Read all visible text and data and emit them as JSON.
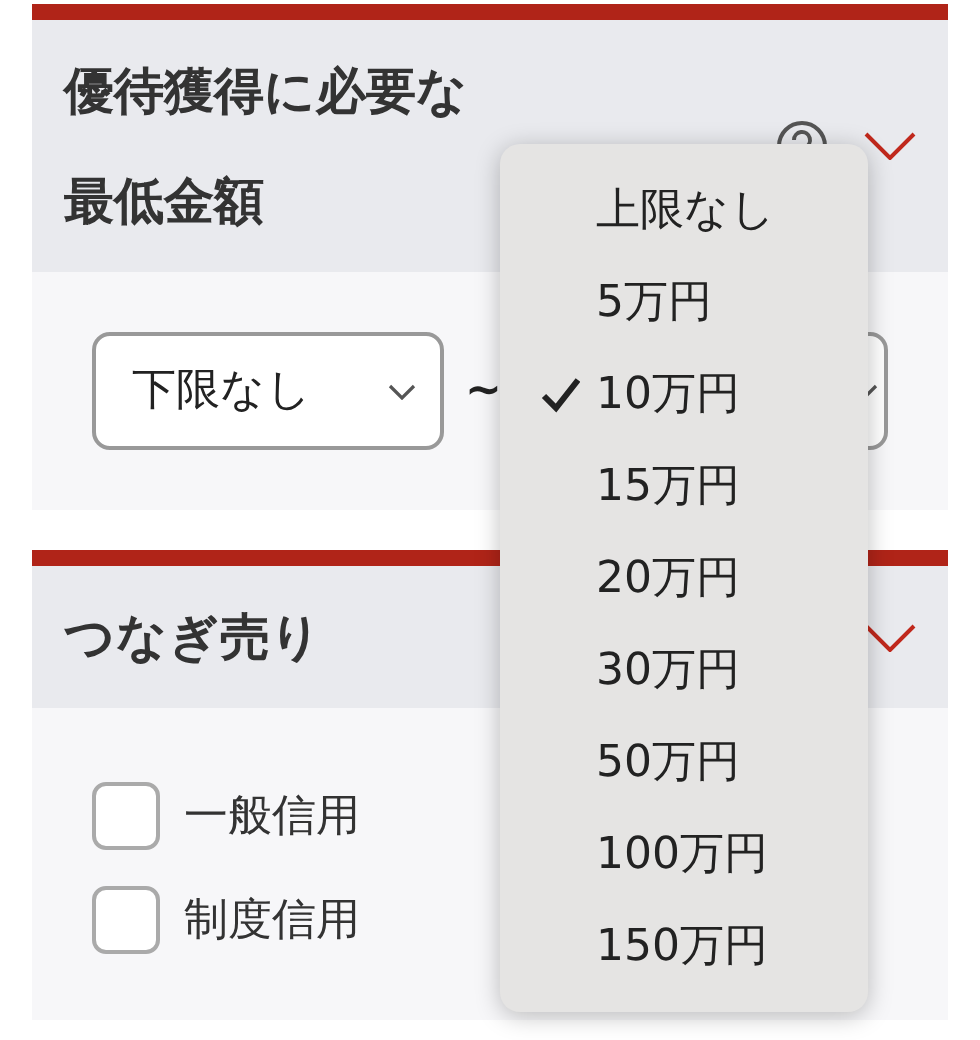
{
  "sections": [
    {
      "kind": "range",
      "title_lines": [
        "優待獲得に必要な",
        "最低金額"
      ],
      "help": true,
      "lower": {
        "value": "下限なし"
      },
      "separator": "~"
    },
    {
      "kind": "checkboxes",
      "title_lines": [
        "つなぎ売り"
      ],
      "help": false,
      "options": [
        {
          "label": "一般信用",
          "checked": false
        },
        {
          "label": "制度信用",
          "checked": false
        }
      ]
    }
  ],
  "dropdown": {
    "options": [
      {
        "label": "上限なし",
        "selected": false
      },
      {
        "label": "5万円",
        "selected": false
      },
      {
        "label": "10万円",
        "selected": true
      },
      {
        "label": "15万円",
        "selected": false
      },
      {
        "label": "20万円",
        "selected": false
      },
      {
        "label": "30万円",
        "selected": false
      },
      {
        "label": "50万円",
        "selected": false
      },
      {
        "label": "100万円",
        "selected": false
      },
      {
        "label": "150万円",
        "selected": false
      }
    ]
  }
}
